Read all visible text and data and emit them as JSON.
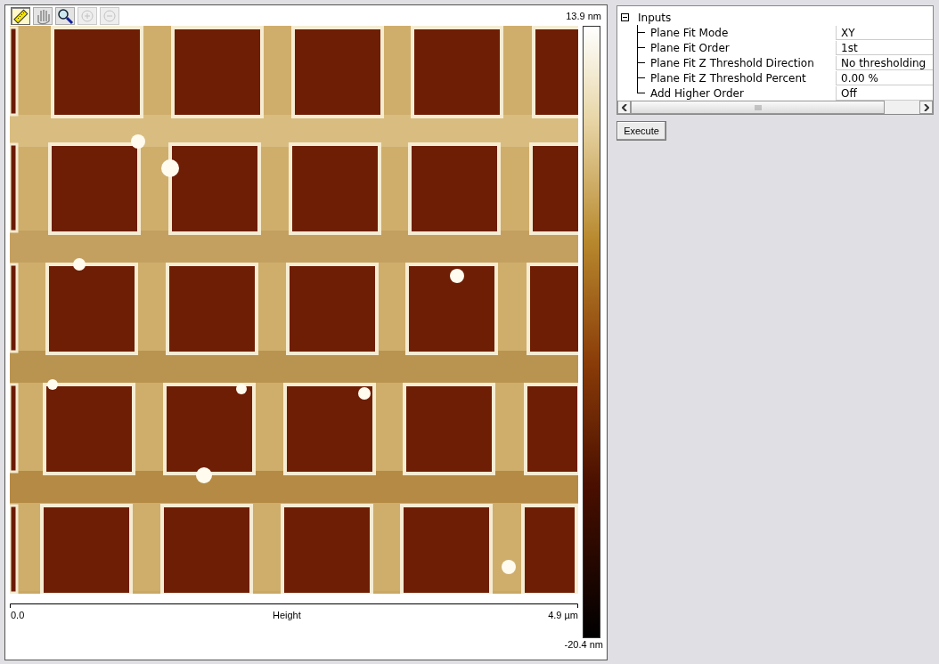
{
  "toolbar": [
    {
      "kind": "ruler",
      "selected": true,
      "disabled": false
    },
    {
      "kind": "hand",
      "selected": false,
      "disabled": false
    },
    {
      "kind": "magnifier",
      "selected": false,
      "disabled": false
    },
    {
      "kind": "zoom-in",
      "selected": false,
      "disabled": true
    },
    {
      "kind": "zoom-out",
      "selected": false,
      "disabled": true
    }
  ],
  "color_scale": {
    "max": "13.9 nm",
    "min": "-20.4 nm"
  },
  "x_axis": {
    "start": "0.0",
    "label": "Height",
    "end": "4.9 µm"
  },
  "properties": {
    "group": "Inputs",
    "expanded": true,
    "rows": [
      {
        "name": "Plane Fit Mode",
        "value": "XY"
      },
      {
        "name": "Plane Fit Order",
        "value": "1st"
      },
      {
        "name": "Plane Fit Z Threshold Direction",
        "value": "No thresholding"
      },
      {
        "name": "Plane Fit Z Threshold Percent",
        "value": "0.00 %"
      },
      {
        "name": "Add Higher Order",
        "value": "Off"
      }
    ]
  },
  "execute_button": "Execute"
}
